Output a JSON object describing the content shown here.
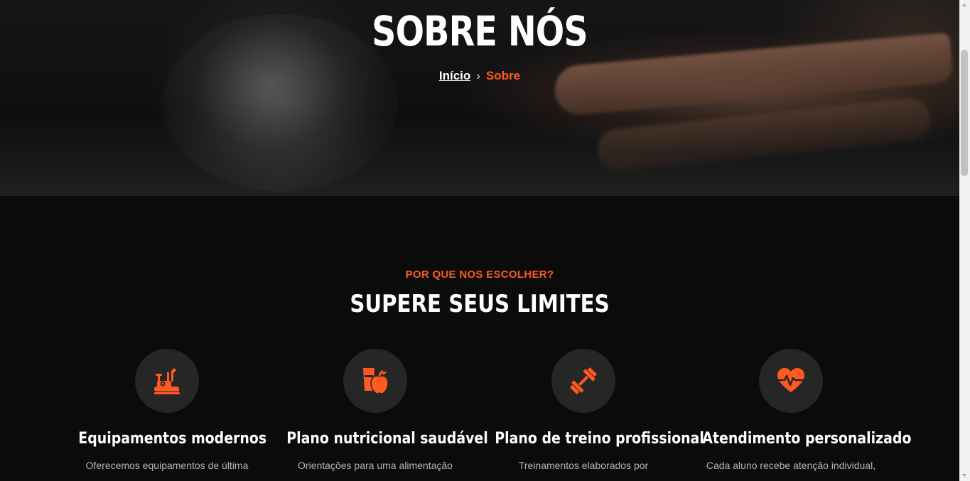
{
  "hero": {
    "title": "SOBRE NÓS",
    "breadcrumb": {
      "home_label": "Início",
      "separator": "›",
      "current_label": "Sobre"
    }
  },
  "why_us": {
    "eyebrow": "POR QUE NOS ESCOLHER?",
    "title": "SUPERE SEUS LIMITES",
    "features": [
      {
        "icon": "gym-equipment-icon",
        "title": "Equipamentos modernos",
        "description": "Oferecemos equipamentos de última"
      },
      {
        "icon": "nutrition-apple-icon",
        "title": "Plano nutricional saudável",
        "description": "Orientações para uma alimentação"
      },
      {
        "icon": "dumbbell-icon",
        "title": "Plano de treino profissional",
        "description": "Treinamentos elaborados por"
      },
      {
        "icon": "heartbeat-icon",
        "title": "Atendimento personalizado",
        "description": "Cada aluno recebe atenção individual,"
      }
    ]
  },
  "colors": {
    "accent": "#ff5a1f",
    "background": "#0b0b0b",
    "icon_circle": "#262626",
    "muted_text": "#b5b5b5"
  }
}
